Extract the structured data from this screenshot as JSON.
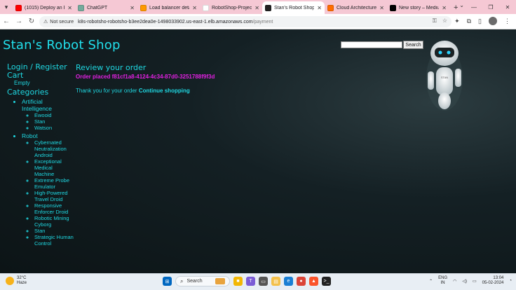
{
  "browser": {
    "tabs": [
      {
        "title": "(1015) Deploy an E",
        "icon": "youtube-icon",
        "color": "#ff0000",
        "active": false
      },
      {
        "title": "ChatGPT",
        "icon": "chatgpt-icon",
        "color": "#74aa9c",
        "active": false
      },
      {
        "title": "Load balancer detai",
        "icon": "aws-icon",
        "color": "#ff9900",
        "active": false
      },
      {
        "title": "RobotShop-Project",
        "icon": "github-icon",
        "color": "#ffffff",
        "active": false
      },
      {
        "title": "Stan's Robot Shop",
        "icon": "robot-icon",
        "color": "#222222",
        "active": true
      },
      {
        "title": "Cloud Architecture",
        "icon": "cloud-icon",
        "color": "#ff6d00",
        "active": false
      },
      {
        "title": "New story – Mediu",
        "icon": "medium-icon",
        "color": "#000000",
        "active": false
      }
    ],
    "new_tab_label": "+",
    "address": {
      "security_label": "Not secure",
      "host": "k8s-robotsho-robotsho-b3ee2dea0e-1498033902.us-east-1.elb.amazonaws.com",
      "path": "/payment"
    }
  },
  "site": {
    "brand": "Stan's Robot Shop",
    "search_button": "Search",
    "search_value": "",
    "accent_color": "#1fd8e2",
    "order_color": "#e020e0"
  },
  "sidebar": {
    "login_label": "Login / Register",
    "cart_label": "Cart",
    "cart_status": "Empty",
    "categories_label": "Categories",
    "categories": [
      {
        "name": "Artificial Intelligence",
        "items": [
          "Ewooid",
          "Stan",
          "Watson"
        ]
      },
      {
        "name": "Robot",
        "items": [
          "Cybernated Neutralization Android",
          "Exceptional Medical Machine",
          "Extreme Probe Emulator",
          "High-Powered Travel Droid",
          "Responsive Enforcer Droid",
          "Robotic Mining Cyborg",
          "Stan",
          "Strategic Human Control"
        ]
      }
    ]
  },
  "main": {
    "heading": "Review your order",
    "order_text": "Order placed f81cf1a8-4124-4c34-87d0-3251788f9f3d",
    "thanks_text": "Thank you for your order",
    "continue_label": "Continue shopping"
  },
  "taskbar": {
    "temperature": "32°C",
    "condition": "Haze",
    "search_label": "Search",
    "lang_line1": "ENG",
    "lang_line2": "IN",
    "time": "13:04",
    "date": "05-02-2024"
  }
}
